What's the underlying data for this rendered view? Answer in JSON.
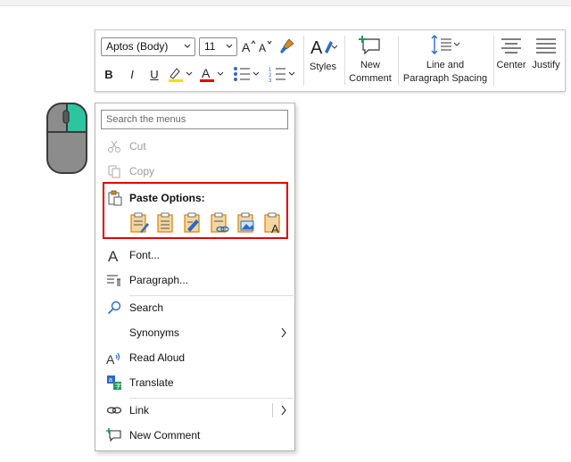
{
  "toolbar": {
    "font_name": "Aptos (Body)",
    "font_size": "11",
    "styles_label": "Styles",
    "new_comment_label_1": "New",
    "new_comment_label_2": "Comment",
    "line_spacing_label_1": "Line and",
    "line_spacing_label_2": "Paragraph Spacing",
    "center_label": "Center",
    "justify_label": "Justify",
    "bold": "B",
    "italic": "I",
    "underline": "U",
    "highlight_color": "#f2e000",
    "font_color": "#e00000"
  },
  "menu": {
    "search_placeholder": "Search the menus",
    "cut": "Cut",
    "copy": "Copy",
    "paste_options": "Paste Options:",
    "font": "Font...",
    "paragraph": "Paragraph...",
    "search": "Search",
    "synonyms": "Synonyms",
    "read_aloud": "Read Aloud",
    "translate": "Translate",
    "link": "Link",
    "new_comment": "New Comment"
  },
  "colors": {
    "accent_blue": "#2b6cc4",
    "paste_orange": "#d98a1a",
    "highlight_border": "#e00000",
    "mouse_button": "#2fc4a0"
  }
}
